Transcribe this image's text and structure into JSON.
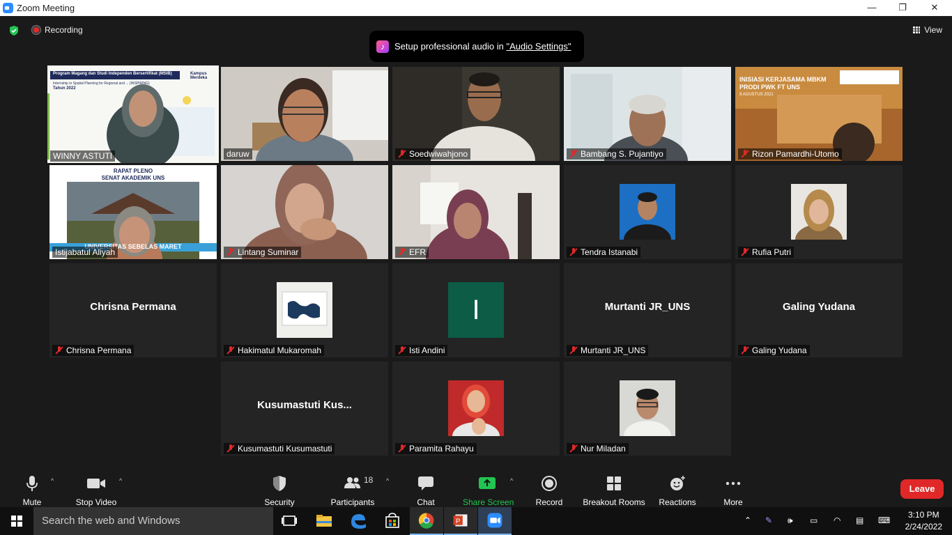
{
  "window": {
    "title": "Zoom Meeting",
    "minimize": "—",
    "maximize": "❐",
    "close": "✕"
  },
  "status": {
    "recording_label": "Recording",
    "view_label": "View"
  },
  "banner": {
    "text": "Setup professional audio in ",
    "link": "\"Audio Settings\""
  },
  "tiles": [
    {
      "name": "WINNY ASTUTI",
      "muted": false,
      "active": true,
      "slide_title": "Program Magang dan Studi Independen Bersertifikat (MSIB)",
      "slide_sub": "Internship in Spatial Planning for Regional and ... (INSPIRING)",
      "slide_year": "Tahun 2022",
      "logo_text": "Kampus Merdeka"
    },
    {
      "name": "daruw",
      "muted": false
    },
    {
      "name": "Soedwiwahjono",
      "muted": true
    },
    {
      "name": "Bambang S. Pujantiyo",
      "muted": true
    },
    {
      "name": "Rizon Pamardhi-Utomo",
      "muted": true,
      "bg_line1": "INISIASI KERJASAMA MBKM",
      "bg_line2": "PRODI PWK FT UNS",
      "bg_date": "9 AGUSTUS 2021"
    },
    {
      "name": "Istijabatul Aliyah",
      "muted": false,
      "bg_line1": "RAPAT PLENO",
      "bg_line2": "SENAT AKADEMIK UNS",
      "bg_banner": "UNIVERSITAS SEBELAS MARET"
    },
    {
      "name": "Lintang Suminar",
      "muted": true
    },
    {
      "name": "EFR",
      "muted": true
    },
    {
      "name": "Tendra Istanabi",
      "muted": true
    },
    {
      "name": "Rufia Putri",
      "muted": true
    },
    {
      "name": "Chrisna Permana",
      "muted": true,
      "big": "Chrisna Permana"
    },
    {
      "name": "Hakimatul Mukaromah",
      "muted": true
    },
    {
      "name": "Isti Andini",
      "muted": true,
      "letter": "I"
    },
    {
      "name": "Murtanti JR_UNS",
      "muted": true,
      "big": "Murtanti JR_UNS"
    },
    {
      "name": "Galing Yudana",
      "muted": true,
      "big": "Galing Yudana"
    },
    {
      "name": "Kusumastuti Kusumastuti",
      "muted": true,
      "big": "Kusumastuti  Kus..."
    },
    {
      "name": "Paramita Rahayu",
      "muted": true
    },
    {
      "name": "Nur Miladan",
      "muted": true
    }
  ],
  "toolbar": {
    "mute": "Mute",
    "stop_video": "Stop Video",
    "security": "Security",
    "participants": "Participants",
    "participants_count": "18",
    "chat": "Chat",
    "share_screen": "Share Screen",
    "record": "Record",
    "breakout_rooms": "Breakout Rooms",
    "reactions": "Reactions",
    "more": "More",
    "leave": "Leave"
  },
  "taskbar": {
    "search_placeholder": "Search the web and Windows",
    "time": "3:10 PM",
    "date": "2/24/2022"
  },
  "colors": {
    "active_speaker": "#f3f06a",
    "leave": "#e02828",
    "share_green": "#23c552",
    "zoom_blue": "#2d8cff"
  }
}
